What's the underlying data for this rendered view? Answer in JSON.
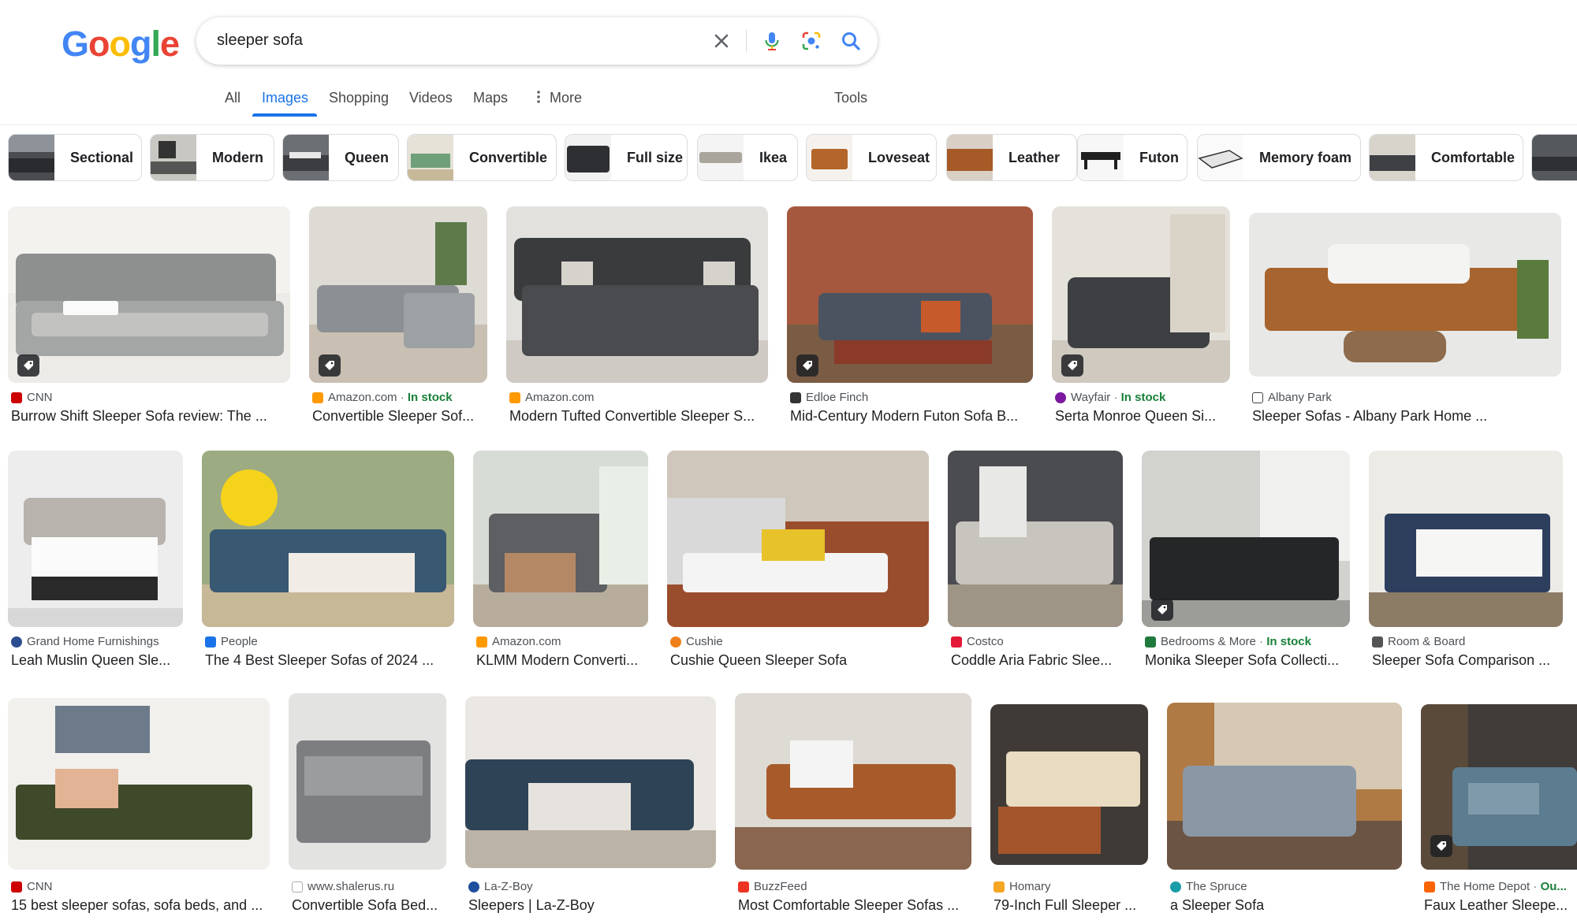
{
  "search": {
    "query": "sleeper sofa"
  },
  "logo": {
    "letters": [
      "G",
      "o",
      "o",
      "g",
      "l",
      "e"
    ]
  },
  "nav": {
    "tabs": [
      "All",
      "Images",
      "Shopping",
      "Videos",
      "Maps",
      "More"
    ],
    "more_icon": "vertical-dots-icon",
    "tools": "Tools"
  },
  "chips": [
    "Sectional",
    "Modern",
    "Queen",
    "Convertible",
    "Full size",
    "Ikea",
    "Loveseat",
    "Leather",
    "Futon",
    "Memory foam",
    "Comfortable"
  ],
  "results": {
    "row1": [
      {
        "source": "CNN",
        "stock": "",
        "title": "Burrow Shift Sleeper Sofa review: The ..."
      },
      {
        "source": "Amazon.com",
        "stock": "In stock",
        "title": "Convertible Sleeper Sof..."
      },
      {
        "source": "Amazon.com",
        "stock": "",
        "title": "Modern Tufted Convertible Sleeper S..."
      },
      {
        "source": "Edloe Finch",
        "stock": "",
        "title": "Mid-Century Modern Futon Sofa B..."
      },
      {
        "source": "Wayfair",
        "stock": "In stock",
        "title": "Serta Monroe Queen Si..."
      },
      {
        "source": "Albany Park",
        "stock": "",
        "title": "Sleeper Sofas - Albany Park Home ..."
      }
    ],
    "row2": [
      {
        "source": "Grand Home Furnishings",
        "stock": "",
        "title": "Leah Muslin Queen Sle..."
      },
      {
        "source": "People",
        "stock": "",
        "title": "The 4 Best Sleeper Sofas of 2024 ..."
      },
      {
        "source": "Amazon.com",
        "stock": "",
        "title": "KLMM Modern Converti..."
      },
      {
        "source": "Cushie",
        "stock": "",
        "title": "Cushie Queen Sleeper Sofa"
      },
      {
        "source": "Costco",
        "stock": "",
        "title": "Coddle Aria Fabric Slee..."
      },
      {
        "source": "Bedrooms & More",
        "stock": "In stock",
        "title": "Monika Sleeper Sofa Collecti..."
      },
      {
        "source": "Room & Board",
        "stock": "",
        "title": "Sleeper Sofa Comparison ..."
      }
    ],
    "row3": [
      {
        "source": "CNN",
        "stock": "",
        "title": "15 best sleeper sofas, sofa beds, and ..."
      },
      {
        "source": "www.shalerus.ru",
        "stock": "",
        "title": "Convertible Sofa Bed..."
      },
      {
        "source": "La-Z-Boy",
        "stock": "",
        "title": "Sleepers | La-Z-Boy"
      },
      {
        "source": "BuzzFeed",
        "stock": "",
        "title": "Most Comfortable Sleeper Sofas ..."
      },
      {
        "source": "Homary",
        "stock": "",
        "title": "79-Inch Full Sleeper ..."
      },
      {
        "source": "The Spruce",
        "stock": "",
        "title": "a Sleeper Sofa"
      },
      {
        "source": "The Home Depot",
        "stock": "Ou...",
        "title": "Faux Leather Sleepe..."
      }
    ]
  },
  "colors": {
    "accent": "#1a73e8",
    "in_stock": "#188038",
    "google_blue": "#4285F4",
    "google_red": "#EA4335",
    "google_yellow": "#FBBC05",
    "google_green": "#34A853"
  }
}
